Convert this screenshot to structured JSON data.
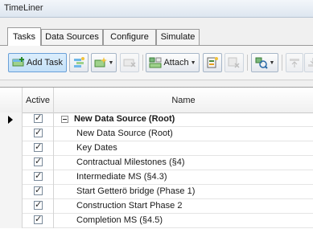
{
  "window": {
    "title": "TimeLiner"
  },
  "tabs": [
    {
      "label": "Tasks",
      "active": true
    },
    {
      "label": "Data Sources",
      "active": false
    },
    {
      "label": "Configure",
      "active": false
    },
    {
      "label": "Simulate",
      "active": false
    }
  ],
  "toolbar": {
    "add_task_label": "Add Task",
    "attach_label": "Attach",
    "buttons": [
      {
        "name": "add-task",
        "icon": "add-task-icon"
      },
      {
        "name": "auto-add-tasks",
        "icon": "auto-add-icon"
      },
      {
        "name": "insert-task",
        "icon": "insert-task-icon"
      },
      {
        "name": "delete-task",
        "icon": "delete-icon",
        "disabled": true
      },
      {
        "name": "attach",
        "icon": "attach-icon"
      },
      {
        "name": "auto-attach-rules",
        "icon": "rules-icon"
      },
      {
        "name": "clear-attachments",
        "icon": "clear-attach-icon",
        "disabled": true
      },
      {
        "name": "find-items",
        "icon": "find-items-icon"
      },
      {
        "name": "move-up",
        "icon": "move-up-icon",
        "disabled": true
      },
      {
        "name": "move-down",
        "icon": "move-down-icon",
        "disabled": true
      }
    ]
  },
  "grid": {
    "headers": {
      "active": "Active",
      "name": "Name"
    },
    "rows": [
      {
        "name": "New Data Source (Root)",
        "active": true,
        "root": true,
        "current": true
      },
      {
        "name": "New Data Source (Root)",
        "active": true
      },
      {
        "name": "Key Dates",
        "active": true
      },
      {
        "name": "Contractual Milestones (§4)",
        "active": true
      },
      {
        "name": "Intermediate MS (§4.3)",
        "active": true
      },
      {
        "name": "Start Getterö bridge (Phase 1)",
        "active": true
      },
      {
        "name": "Construction Start Phase 2",
        "active": true
      },
      {
        "name": "Completion MS (§4.5)",
        "active": true
      }
    ]
  },
  "colors": {
    "accent": "#6aa0d8",
    "tab_border": "#9a9a9a"
  }
}
